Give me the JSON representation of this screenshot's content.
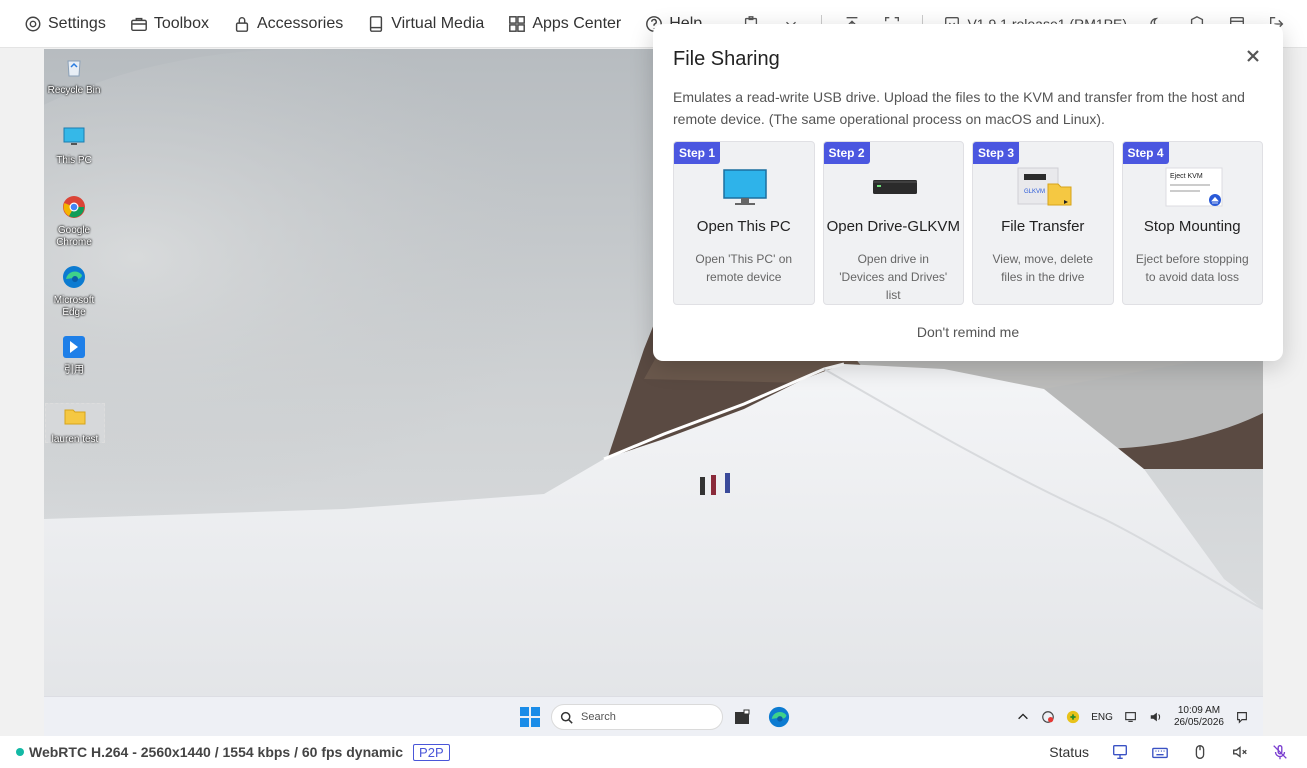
{
  "menu": [
    {
      "label": "Settings",
      "icon": "gear-icon"
    },
    {
      "label": "Toolbox",
      "icon": "toolbox-icon"
    },
    {
      "label": "Accessories",
      "icon": "lock-icon"
    },
    {
      "label": "Virtual Media",
      "icon": "book-icon"
    },
    {
      "label": "Apps Center",
      "icon": "grid-icon"
    },
    {
      "label": "Help",
      "icon": "help-icon"
    }
  ],
  "toolbar": {
    "version": "V1.9.1 release1 (RM1PE)"
  },
  "desktop": {
    "icons": [
      {
        "label": "Recycle Bin"
      },
      {
        "label": "This PC"
      },
      {
        "label": "Google Chrome"
      },
      {
        "label": "Microsoft Edge"
      },
      {
        "label": "引用"
      },
      {
        "label": "lauren test"
      }
    ]
  },
  "taskbar": {
    "search_placeholder": "Search",
    "language": "ENG",
    "time": "10:09 AM",
    "date": "26/05/2026"
  },
  "status": {
    "stream_info": "WebRTC H.264 - 2560x1440 / 1554 kbps / 60 fps dynamic",
    "connection_badge": "P2P",
    "status_label": "Status",
    "indicator_color": "#13b9a5"
  },
  "dialog": {
    "title": "File Sharing",
    "description": "Emulates a read-write USB drive. Upload the files to the KVM and transfer from the host and remote device. (The same operational process on macOS and Linux).",
    "steps": [
      {
        "badge": "Step 1",
        "title": "Open This PC",
        "desc": "Open 'This PC' on remote device"
      },
      {
        "badge": "Step 2",
        "title": "Open Drive-GLKVM",
        "desc": "Open drive in 'Devices and Drives' list"
      },
      {
        "badge": "Step 3",
        "title": "File Transfer",
        "desc": "View, move, delete files in the drive",
        "illus_label": "GLKVM"
      },
      {
        "badge": "Step 4",
        "title": "Stop Mounting",
        "desc": "Eject before stopping to avoid data loss",
        "illus_label": "Eject KVM"
      }
    ],
    "dont_remind": "Don't remind me",
    "accent": "#4b57e0"
  }
}
